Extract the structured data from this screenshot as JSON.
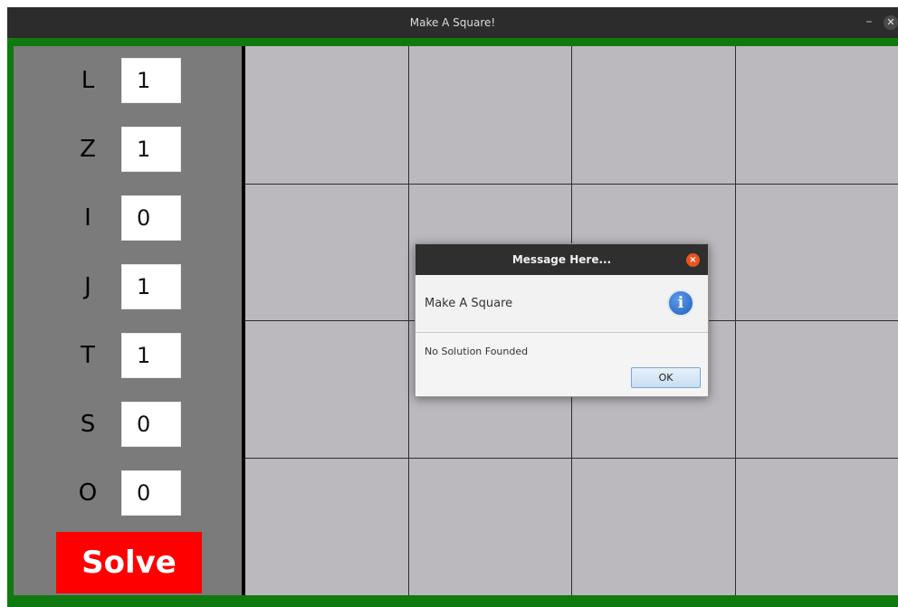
{
  "window": {
    "title": "Make A Square!",
    "minimize_glyph": "–",
    "close_glyph": "✕"
  },
  "pieces": [
    {
      "label": "L",
      "value": "1"
    },
    {
      "label": "Z",
      "value": "1"
    },
    {
      "label": "I",
      "value": "0"
    },
    {
      "label": "J",
      "value": "1"
    },
    {
      "label": "T",
      "value": "1"
    },
    {
      "label": "S",
      "value": "0"
    },
    {
      "label": "O",
      "value": "0"
    }
  ],
  "solve_label": "Solve",
  "board": {
    "rows": 4,
    "cols": 4
  },
  "dialog": {
    "title": "Message Here...",
    "close_glyph": "×",
    "header": "Make A Square",
    "info_glyph": "i",
    "content": "No Solution Founded",
    "ok_label": "OK"
  },
  "colors": {
    "frame": "#0f7a0f",
    "panel": "#7b7b7b",
    "board": "#bbb8be",
    "solve": "#ff0000"
  }
}
